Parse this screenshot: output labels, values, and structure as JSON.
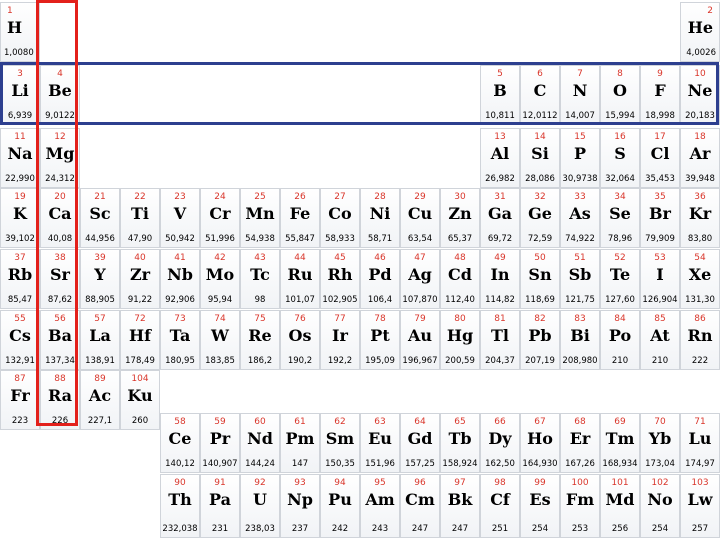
{
  "colors": {
    "highlight_row": "#2d3f8f",
    "highlight_column": "#e3201b",
    "atomic_number": "#d9362b"
  },
  "periods": [
    [
      {
        "n": "1",
        "s": "H",
        "m": "1,0080",
        "col": 1
      },
      {
        "n": "2",
        "s": "He",
        "m": "4,0026",
        "col": 18
      }
    ],
    [
      {
        "n": "3",
        "s": "Li",
        "m": "6,939",
        "col": 1
      },
      {
        "n": "4",
        "s": "Be",
        "m": "9,0122",
        "col": 2
      },
      {
        "n": "5",
        "s": "B",
        "m": "10,811",
        "col": 13
      },
      {
        "n": "6",
        "s": "C",
        "m": "12,0112",
        "col": 14
      },
      {
        "n": "7",
        "s": "N",
        "m": "14,007",
        "col": 15
      },
      {
        "n": "8",
        "s": "O",
        "m": "15,994",
        "col": 16
      },
      {
        "n": "9",
        "s": "F",
        "m": "18,998",
        "col": 17
      },
      {
        "n": "10",
        "s": "Ne",
        "m": "20,183",
        "col": 18
      }
    ],
    [
      {
        "n": "11",
        "s": "Na",
        "m": "22,990",
        "col": 1
      },
      {
        "n": "12",
        "s": "Mg",
        "m": "24,312",
        "col": 2
      },
      {
        "n": "13",
        "s": "Al",
        "m": "26,982",
        "col": 13
      },
      {
        "n": "14",
        "s": "Si",
        "m": "28,086",
        "col": 14
      },
      {
        "n": "15",
        "s": "P",
        "m": "30,9738",
        "col": 15
      },
      {
        "n": "16",
        "s": "S",
        "m": "32,064",
        "col": 16
      },
      {
        "n": "17",
        "s": "Cl",
        "m": "35,453",
        "col": 17
      },
      {
        "n": "18",
        "s": "Ar",
        "m": "39,948",
        "col": 18
      }
    ],
    [
      {
        "n": "19",
        "s": "K",
        "m": "39,102",
        "col": 1
      },
      {
        "n": "20",
        "s": "Ca",
        "m": "40,08",
        "col": 2
      },
      {
        "n": "21",
        "s": "Sc",
        "m": "44,956",
        "col": 3
      },
      {
        "n": "22",
        "s": "Ti",
        "m": "47,90",
        "col": 4
      },
      {
        "n": "23",
        "s": "V",
        "m": "50,942",
        "col": 5
      },
      {
        "n": "24",
        "s": "Cr",
        "m": "51,996",
        "col": 6
      },
      {
        "n": "25",
        "s": "Mn",
        "m": "54,938",
        "col": 7
      },
      {
        "n": "26",
        "s": "Fe",
        "m": "55,847",
        "col": 8
      },
      {
        "n": "27",
        "s": "Co",
        "m": "58,933",
        "col": 9
      },
      {
        "n": "28",
        "s": "Ni",
        "m": "58,71",
        "col": 10
      },
      {
        "n": "29",
        "s": "Cu",
        "m": "63,54",
        "col": 11
      },
      {
        "n": "30",
        "s": "Zn",
        "m": "65,37",
        "col": 12
      },
      {
        "n": "31",
        "s": "Ga",
        "m": "69,72",
        "col": 13
      },
      {
        "n": "32",
        "s": "Ge",
        "m": "72,59",
        "col": 14
      },
      {
        "n": "33",
        "s": "As",
        "m": "74,922",
        "col": 15
      },
      {
        "n": "34",
        "s": "Se",
        "m": "78,96",
        "col": 16
      },
      {
        "n": "35",
        "s": "Br",
        "m": "79,909",
        "col": 17
      },
      {
        "n": "36",
        "s": "Kr",
        "m": "83,80",
        "col": 18
      }
    ],
    [
      {
        "n": "37",
        "s": "Rb",
        "m": "85,47",
        "col": 1
      },
      {
        "n": "38",
        "s": "Sr",
        "m": "87,62",
        "col": 2
      },
      {
        "n": "39",
        "s": "Y",
        "m": "88,905",
        "col": 3
      },
      {
        "n": "40",
        "s": "Zr",
        "m": "91,22",
        "col": 4
      },
      {
        "n": "41",
        "s": "Nb",
        "m": "92,906",
        "col": 5
      },
      {
        "n": "42",
        "s": "Mo",
        "m": "95,94",
        "col": 6
      },
      {
        "n": "43",
        "s": "Tc",
        "m": "98",
        "col": 7
      },
      {
        "n": "44",
        "s": "Ru",
        "m": "101,07",
        "col": 8
      },
      {
        "n": "45",
        "s": "Rh",
        "m": "102,905",
        "col": 9
      },
      {
        "n": "46",
        "s": "Pd",
        "m": "106,4",
        "col": 10
      },
      {
        "n": "47",
        "s": "Ag",
        "m": "107,870",
        "col": 11
      },
      {
        "n": "48",
        "s": "Cd",
        "m": "112,40",
        "col": 12
      },
      {
        "n": "49",
        "s": "In",
        "m": "114,82",
        "col": 13
      },
      {
        "n": "50",
        "s": "Sn",
        "m": "118,69",
        "col": 14
      },
      {
        "n": "51",
        "s": "Sb",
        "m": "121,75",
        "col": 15
      },
      {
        "n": "52",
        "s": "Te",
        "m": "127,60",
        "col": 16
      },
      {
        "n": "53",
        "s": "I",
        "m": "126,904",
        "col": 17
      },
      {
        "n": "54",
        "s": "Xe",
        "m": "131,30",
        "col": 18
      }
    ],
    [
      {
        "n": "55",
        "s": "Cs",
        "m": "132,91",
        "col": 1
      },
      {
        "n": "56",
        "s": "Ba",
        "m": "137,34",
        "col": 2
      },
      {
        "n": "57",
        "s": "La",
        "m": "138,91",
        "col": 3
      },
      {
        "n": "72",
        "s": "Hf",
        "m": "178,49",
        "col": 4
      },
      {
        "n": "73",
        "s": "Ta",
        "m": "180,95",
        "col": 5
      },
      {
        "n": "74",
        "s": "W",
        "m": "183,85",
        "col": 6
      },
      {
        "n": "75",
        "s": "Re",
        "m": "186,2",
        "col": 7
      },
      {
        "n": "76",
        "s": "Os",
        "m": "190,2",
        "col": 8
      },
      {
        "n": "77",
        "s": "Ir",
        "m": "192,2",
        "col": 9
      },
      {
        "n": "78",
        "s": "Pt",
        "m": "195,09",
        "col": 10
      },
      {
        "n": "79",
        "s": "Au",
        "m": "196,967",
        "col": 11
      },
      {
        "n": "80",
        "s": "Hg",
        "m": "200,59",
        "col": 12
      },
      {
        "n": "81",
        "s": "Tl",
        "m": "204,37",
        "col": 13
      },
      {
        "n": "82",
        "s": "Pb",
        "m": "207,19",
        "col": 14
      },
      {
        "n": "83",
        "s": "Bi",
        "m": "208,980",
        "col": 15
      },
      {
        "n": "84",
        "s": "Po",
        "m": "210",
        "col": 16
      },
      {
        "n": "85",
        "s": "At",
        "m": "210",
        "col": 17
      },
      {
        "n": "86",
        "s": "Rn",
        "m": "222",
        "col": 18
      }
    ],
    [
      {
        "n": "87",
        "s": "Fr",
        "m": "223",
        "col": 1
      },
      {
        "n": "88",
        "s": "Ra",
        "m": "226",
        "col": 2
      },
      {
        "n": "89",
        "s": "Ac",
        "m": "227,1",
        "col": 3
      },
      {
        "n": "104",
        "s": "Ku",
        "m": "260",
        "col": 4
      }
    ]
  ],
  "lanthanides": [
    {
      "n": "58",
      "s": "Ce",
      "m": "140,12"
    },
    {
      "n": "59",
      "s": "Pr",
      "m": "140,907"
    },
    {
      "n": "60",
      "s": "Nd",
      "m": "144,24"
    },
    {
      "n": "61",
      "s": "Pm",
      "m": "147"
    },
    {
      "n": "62",
      "s": "Sm",
      "m": "150,35"
    },
    {
      "n": "63",
      "s": "Eu",
      "m": "151,96"
    },
    {
      "n": "64",
      "s": "Gd",
      "m": "157,25"
    },
    {
      "n": "65",
      "s": "Tb",
      "m": "158,924"
    },
    {
      "n": "66",
      "s": "Dy",
      "m": "162,50"
    },
    {
      "n": "67",
      "s": "Ho",
      "m": "164,930"
    },
    {
      "n": "68",
      "s": "Er",
      "m": "167,26"
    },
    {
      "n": "69",
      "s": "Tm",
      "m": "168,934"
    },
    {
      "n": "70",
      "s": "Yb",
      "m": "173,04"
    },
    {
      "n": "71",
      "s": "Lu",
      "m": "174,97"
    }
  ],
  "actinides": [
    {
      "n": "90",
      "s": "Th",
      "m": "232,038"
    },
    {
      "n": "91",
      "s": "Pa",
      "m": "231"
    },
    {
      "n": "92",
      "s": "U",
      "m": "238,03"
    },
    {
      "n": "93",
      "s": "Np",
      "m": "237"
    },
    {
      "n": "94",
      "s": "Pu",
      "m": "242"
    },
    {
      "n": "95",
      "s": "Am",
      "m": "243"
    },
    {
      "n": "96",
      "s": "Cm",
      "m": "247"
    },
    {
      "n": "97",
      "s": "Bk",
      "m": "247"
    },
    {
      "n": "98",
      "s": "Cf",
      "m": "251"
    },
    {
      "n": "99",
      "s": "Es",
      "m": "254"
    },
    {
      "n": "100",
      "s": "Fm",
      "m": "253"
    },
    {
      "n": "101",
      "s": "Md",
      "m": "256"
    },
    {
      "n": "102",
      "s": "No",
      "m": "254"
    },
    {
      "n": "103",
      "s": "Lw",
      "m": "257"
    }
  ]
}
